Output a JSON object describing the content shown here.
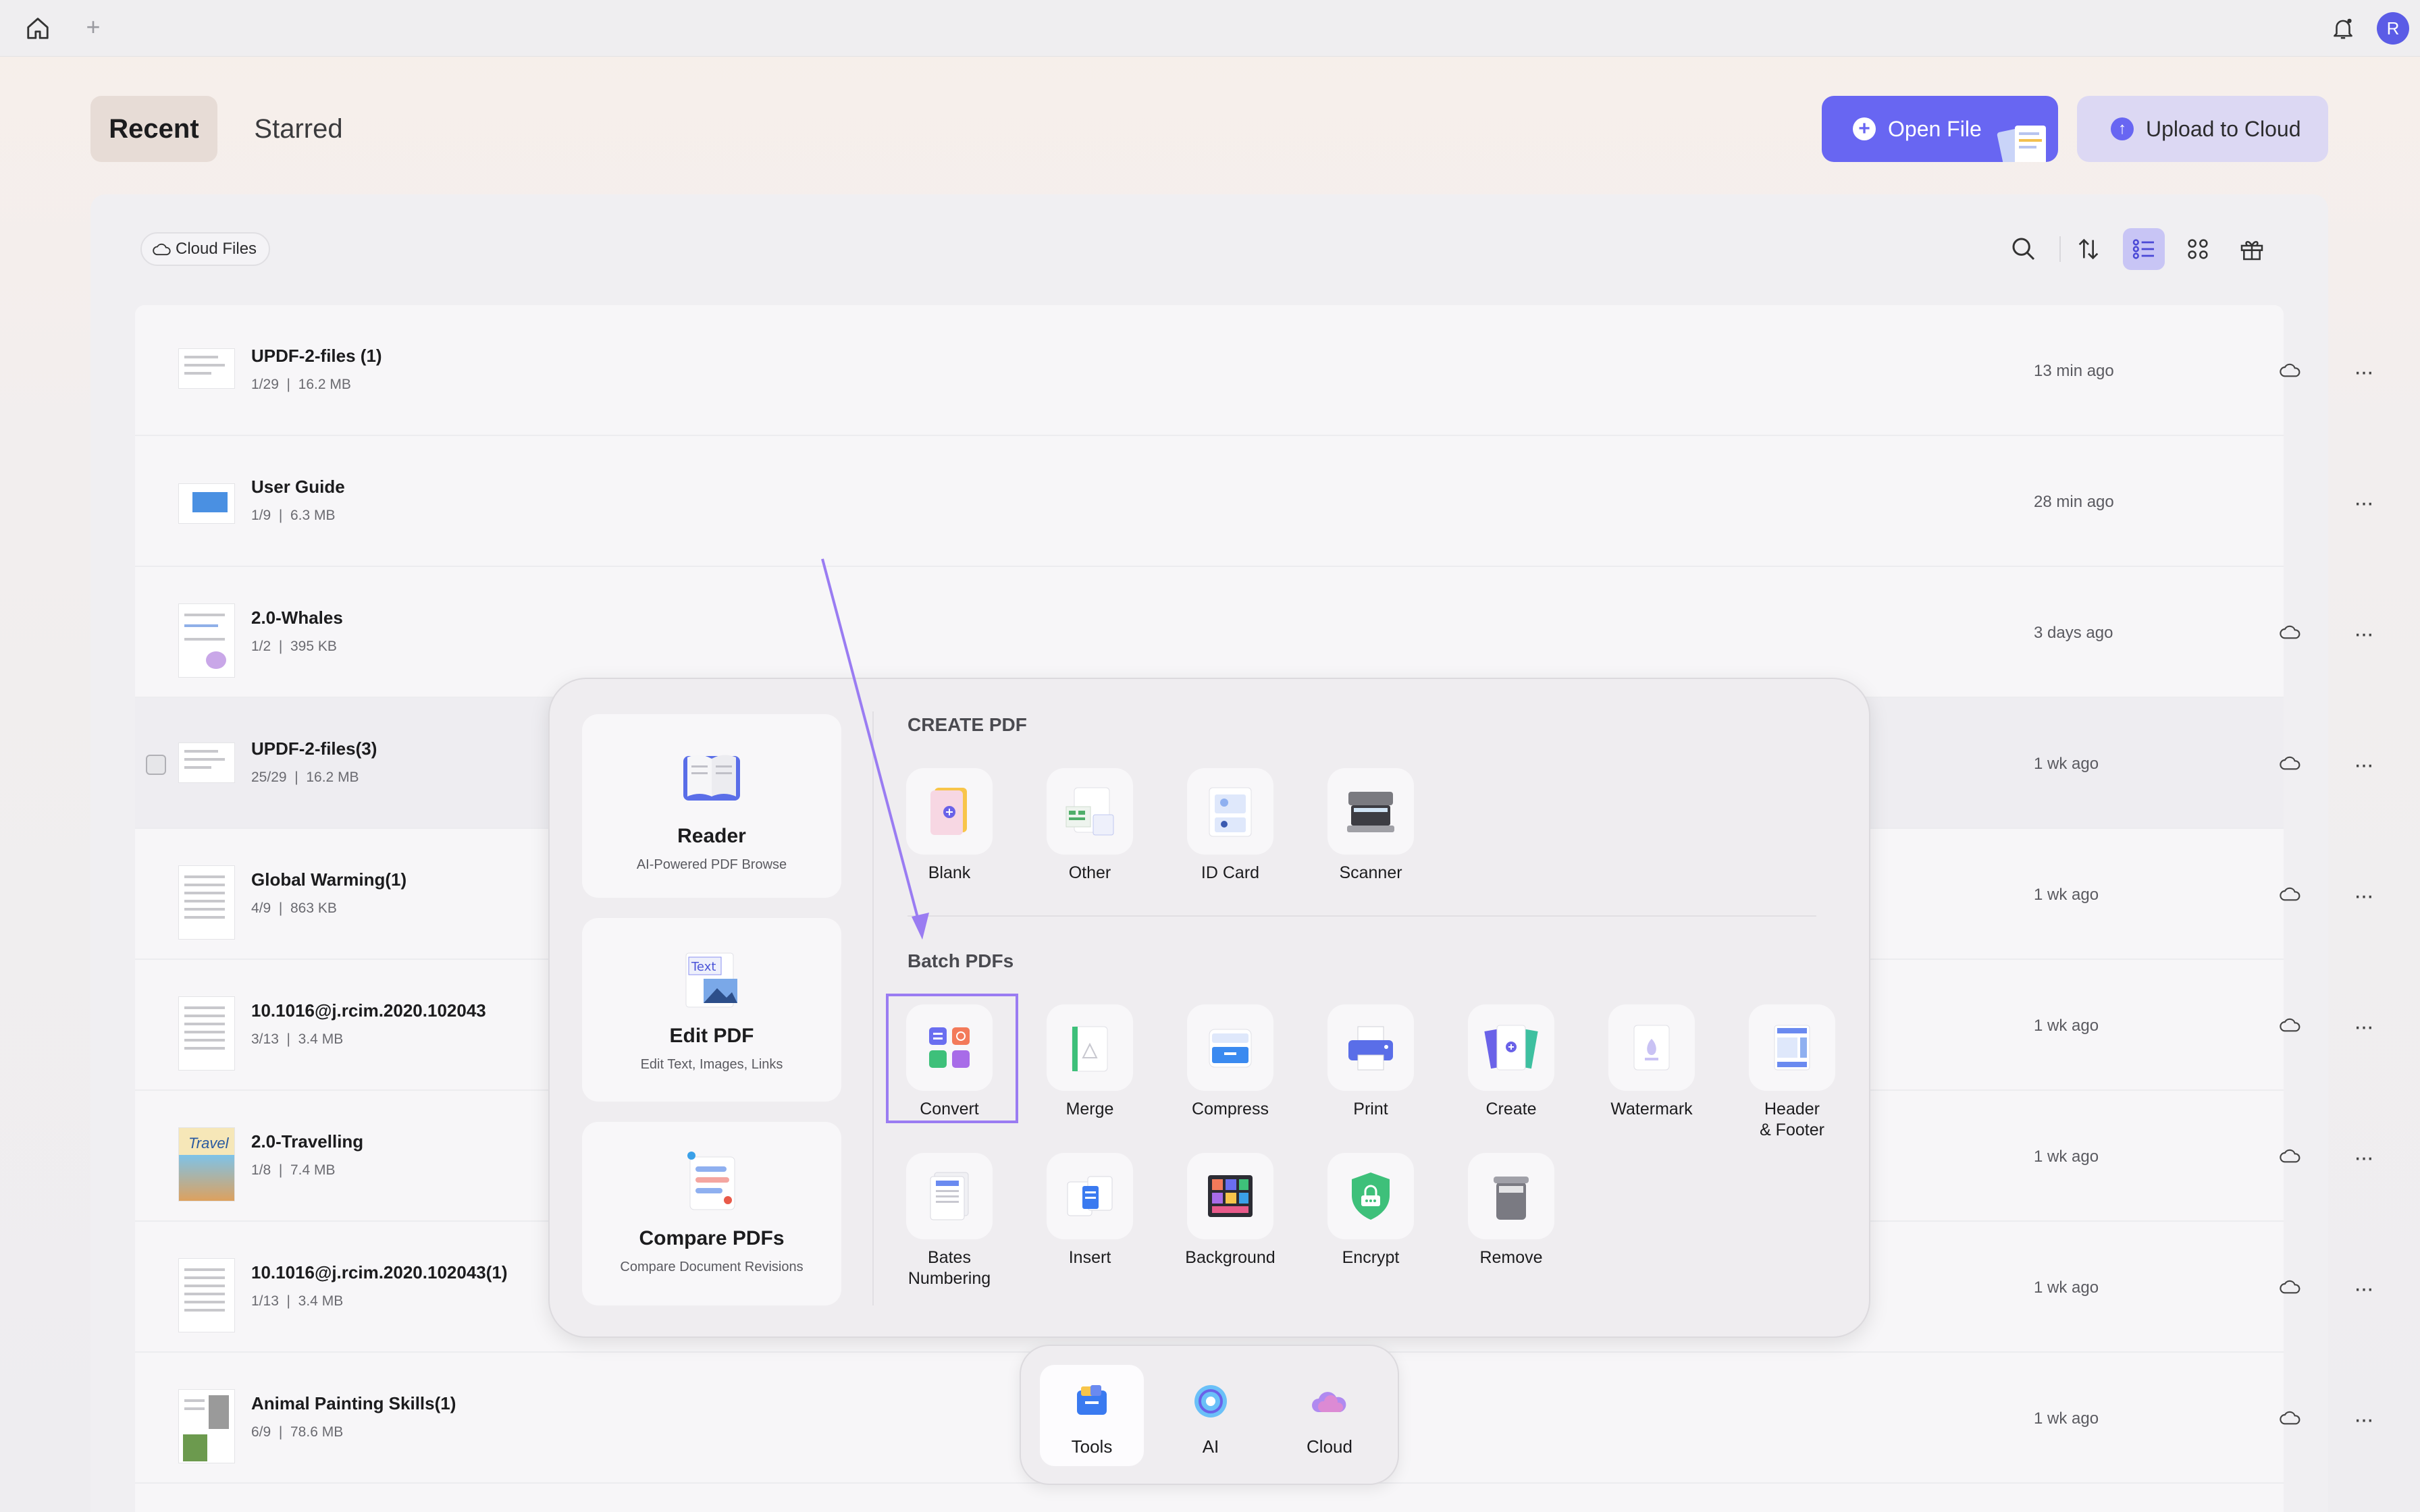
{
  "topbar": {
    "home_icon": "home-icon",
    "add_tab_icon": "plus-icon",
    "bell_icon": "bell-icon",
    "avatar_initial": "R"
  },
  "tabs": [
    {
      "label": "Recent",
      "active": true
    },
    {
      "label": "Starred",
      "active": false
    }
  ],
  "actions": {
    "open_file": "Open File",
    "upload_cloud": "Upload to Cloud"
  },
  "filter_chip": "Cloud Files",
  "toolbar_icons": [
    "search-icon",
    "sort-icon",
    "list-view-icon",
    "grid-view-icon",
    "gift-icon"
  ],
  "files": [
    {
      "name": "UPDF-2-files (1)",
      "pages": "1/29",
      "size": "16.2 MB",
      "time": "13 min ago",
      "cloud": true
    },
    {
      "name": "User Guide",
      "pages": "1/9",
      "size": "6.3 MB",
      "time": "28 min ago",
      "cloud": false
    },
    {
      "name": "2.0-Whales",
      "pages": "1/2",
      "size": "395 KB",
      "time": "3 days ago",
      "cloud": true
    },
    {
      "name": "UPDF-2-files(3)",
      "pages": "25/29",
      "size": "16.2 MB",
      "time": "1 wk ago",
      "cloud": true
    },
    {
      "name": "Global Warming(1)",
      "pages": "4/9",
      "size": "863 KB",
      "time": "1 wk ago",
      "cloud": true
    },
    {
      "name": "10.1016@j.rcim.2020.102043",
      "pages": "3/13",
      "size": "3.4 MB",
      "time": "1 wk ago",
      "cloud": true
    },
    {
      "name": "2.0-Travelling",
      "pages": "1/8",
      "size": "7.4 MB",
      "time": "1 wk ago",
      "cloud": true
    },
    {
      "name": "10.1016@j.rcim.2020.102043(1)",
      "pages": "1/13",
      "size": "3.4 MB",
      "time": "1 wk ago",
      "cloud": true
    },
    {
      "name": "Animal Painting Skills(1)",
      "pages": "6/9",
      "size": "78.6 MB",
      "time": "1 wk ago",
      "cloud": true
    }
  ],
  "popup": {
    "cards": [
      {
        "title": "Reader",
        "subtitle": "AI-Powered PDF Browse"
      },
      {
        "title": "Edit PDF",
        "subtitle": "Edit Text, Images, Links",
        "icon_text": "Text"
      },
      {
        "title": "Compare PDFs",
        "subtitle": "Compare Document Revisions"
      }
    ],
    "create_title": "CREATE PDF",
    "create_tools": [
      "Blank",
      "Other",
      "ID Card",
      "Scanner"
    ],
    "batch_title": "Batch PDFs",
    "batch_tools": [
      "Convert",
      "Merge",
      "Compress",
      "Print",
      "Create",
      "Watermark",
      "Header\n& Footer",
      "Bates\nNumbering",
      "Insert",
      "Background",
      "Encrypt",
      "Remove"
    ]
  },
  "dock": [
    {
      "label": "Tools",
      "active": true
    },
    {
      "label": "AI",
      "active": false
    },
    {
      "label": "Cloud",
      "active": false
    }
  ],
  "colors": {
    "accent": "#6866f2",
    "highlight": "#9a7cf2"
  }
}
